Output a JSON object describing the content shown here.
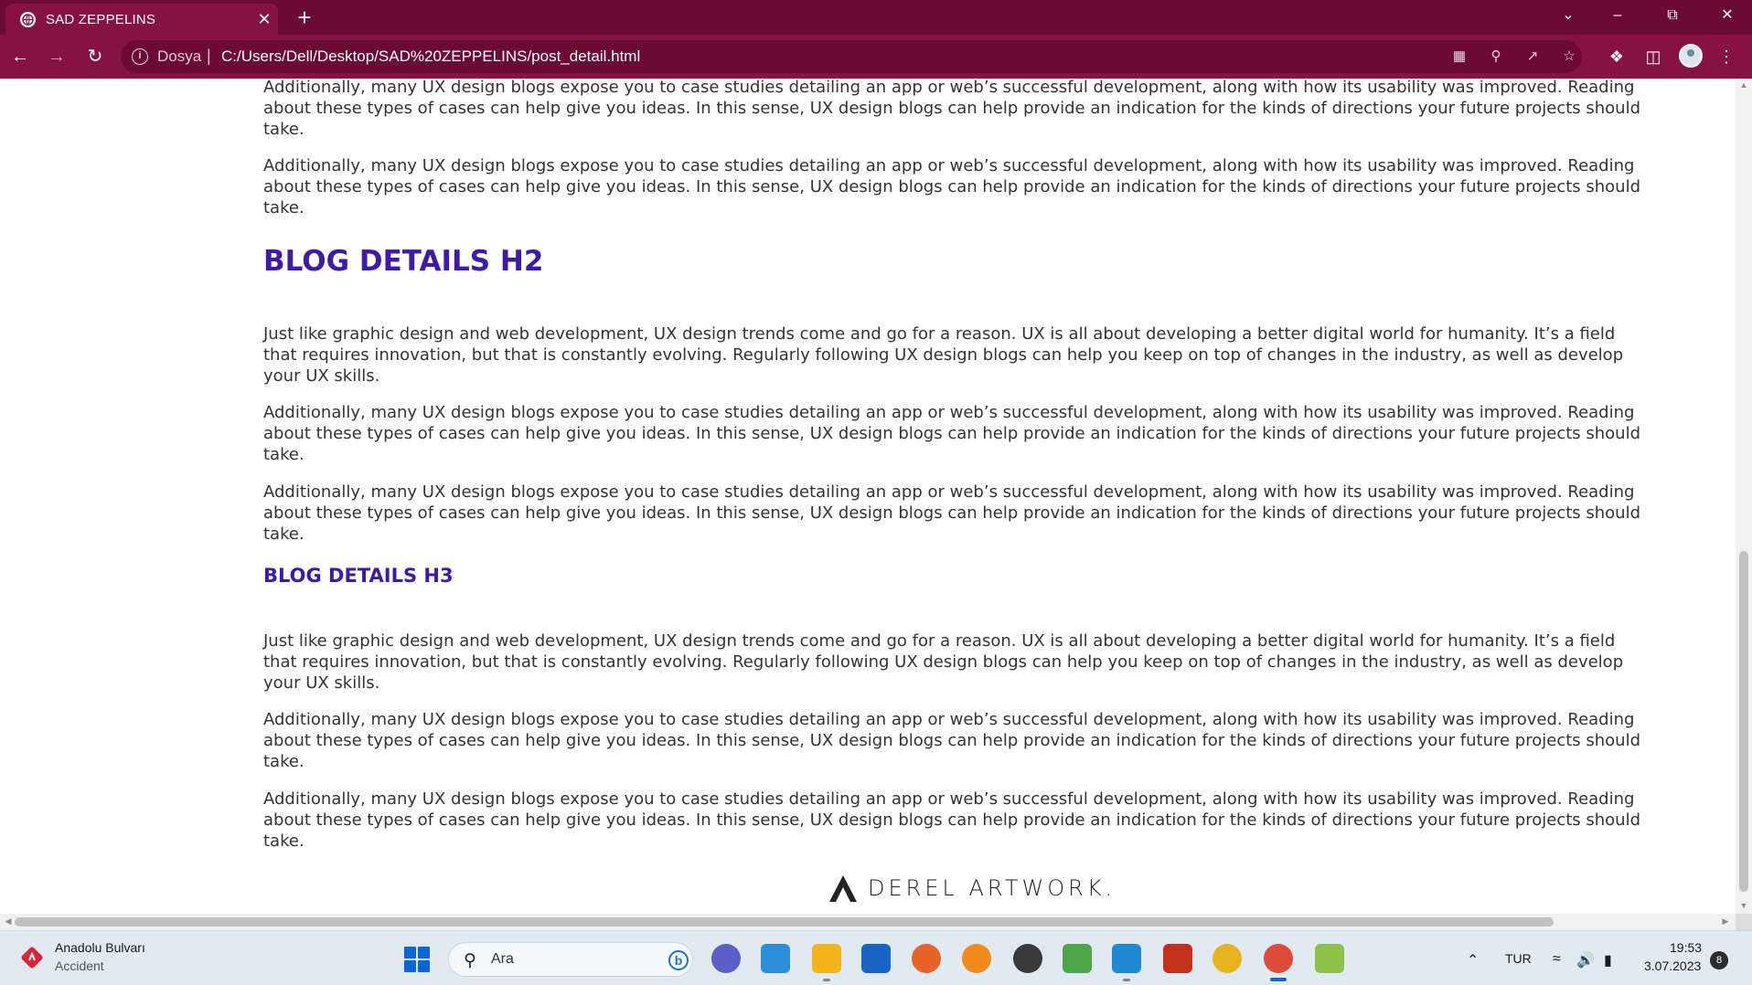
{
  "browser": {
    "tab_title": "SAD ZEPPELINS",
    "tab_close": "✕",
    "new_tab": "+",
    "url_scheme": "Dosya",
    "url_separator": "|",
    "url": "C:/Users/Dell/Desktop/SAD%20ZEPPELINS/post_detail.html"
  },
  "page": {
    "top_paras": [
      "Additionally, many UX design blogs expose you to case studies detailing an app or web’s successful development, along with how its usability was improved. Reading about these types of cases can help give you ideas. In this sense, UX design blogs can help provide an indication for the kinds of directions your future projects should take.",
      "Additionally, many UX design blogs expose you to case studies detailing an app or web’s successful development, along with how its usability was improved. Reading about these types of cases can help give you ideas. In this sense, UX design blogs can help provide an indication for the kinds of directions your future projects should take."
    ],
    "h2": "BLOG DETAILS H2",
    "h2_paras": [
      "Just like graphic design and web development, UX design trends come and go for a reason. UX is all about developing a better digital world for humanity. It’s a field that requires innovation, but that is constantly evolving. Regularly following UX design blogs can help you keep on top of changes in the industry, as well as develop your UX skills.",
      "Additionally, many UX design blogs expose you to case studies detailing an app or web’s successful development, along with how its usability was improved. Reading about these types of cases can help give you ideas. In this sense, UX design blogs can help provide an indication for the kinds of directions your future projects should take.",
      "Additionally, many UX design blogs expose you to case studies detailing an app or web’s successful development, along with how its usability was improved. Reading about these types of cases can help give you ideas. In this sense, UX design blogs can help provide an indication for the kinds of directions your future projects should take."
    ],
    "h3": "BLOG DETAILS H3",
    "h3_paras": [
      "Just like graphic design and web development, UX design trends come and go for a reason. UX is all about developing a better digital world for humanity. It’s a field that requires innovation, but that is constantly evolving. Regularly following UX design blogs can help you keep on top of changes in the industry, as well as develop your UX skills.",
      "Additionally, many UX design blogs expose you to case studies detailing an app or web’s successful development, along with how its usability was improved. Reading about these types of cases can help give you ideas. In this sense, UX design blogs can help provide an indication for the kinds of directions your future projects should take.",
      "Additionally, many UX design blogs expose you to case studies detailing an app or web’s successful development, along with how its usability was improved. Reading about these types of cases can help give you ideas. In this sense, UX design blogs can help provide an indication for the kinds of directions your future projects should take."
    ],
    "footer_logo": "DEREL ARTWORK."
  },
  "taskbar": {
    "weather_title": "Anadolu Bulvarı",
    "weather_sub": "Accident",
    "search_label": "Ara",
    "bing": "b",
    "language": "TUR",
    "time": "19:53",
    "date": "3.07.2023",
    "notifications": "8"
  },
  "colors": {
    "chrome_dark": "#6b0a33",
    "chrome": "#861244",
    "heading": "#3f1aa6",
    "body_text": "#333333"
  }
}
